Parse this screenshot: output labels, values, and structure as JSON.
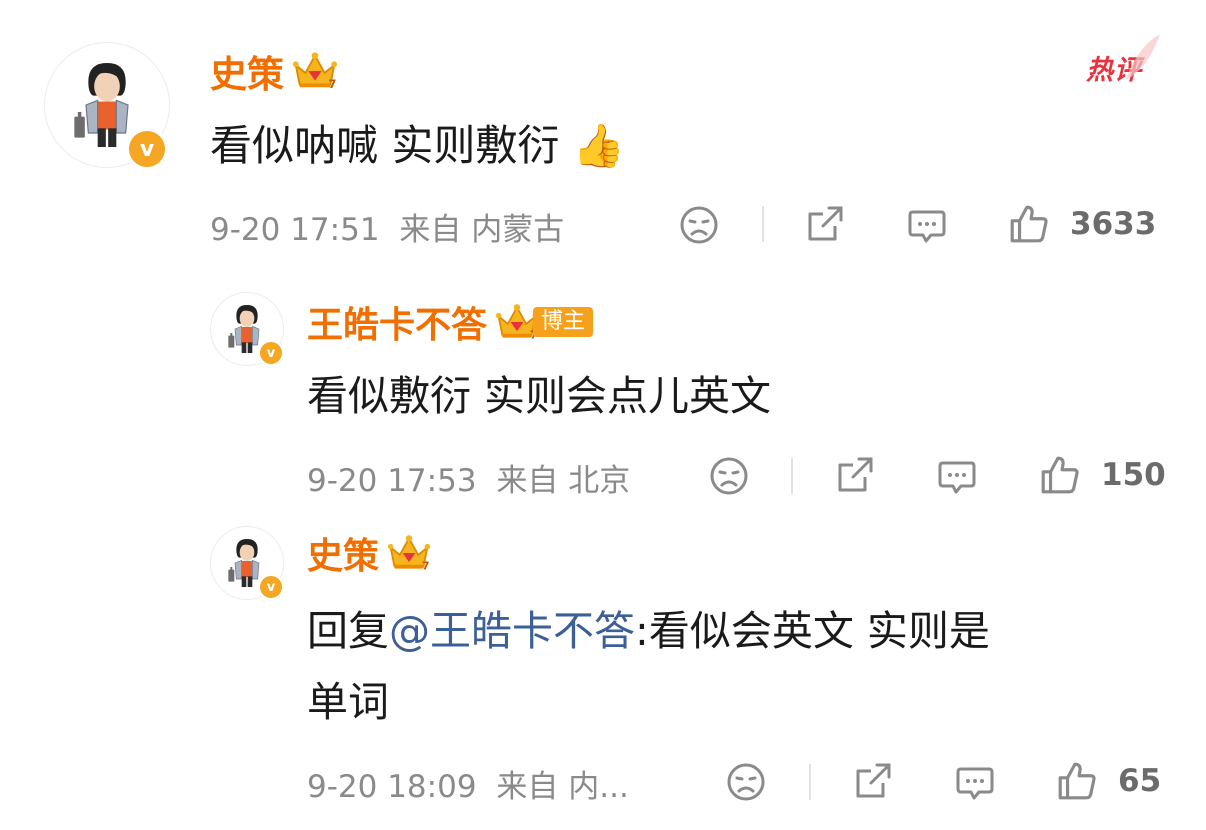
{
  "hot_label": "热评",
  "comments": [
    {
      "user": "史策",
      "text": "看似呐喊 实则敷衍",
      "emoji": "👍",
      "time": "9-20 17:51",
      "location": "来自 内蒙古",
      "likes": "3633"
    },
    {
      "user": "王皓卡不答",
      "badge": "博主",
      "text": "看似敷衍 实则会点儿英文",
      "time": "9-20 17:53",
      "location": "来自 北京",
      "likes": "150"
    },
    {
      "user": "史策",
      "reply_prefix": "回复",
      "reply_mention": "@王皓卡不答",
      "reply_text_line1": ":看似会英文 实则是",
      "reply_text_line2": "单词",
      "time": "9-20 18:09",
      "location": "来自 内...",
      "likes": "65"
    }
  ],
  "icons": [
    "dislike-icon",
    "share-icon",
    "comment-icon",
    "like-icon",
    "crown-icon",
    "verified-icon"
  ],
  "colors": {
    "username": "#f06f00",
    "mention": "#3d5f98",
    "hot": "#e8333f",
    "verified": "#f5a623"
  }
}
